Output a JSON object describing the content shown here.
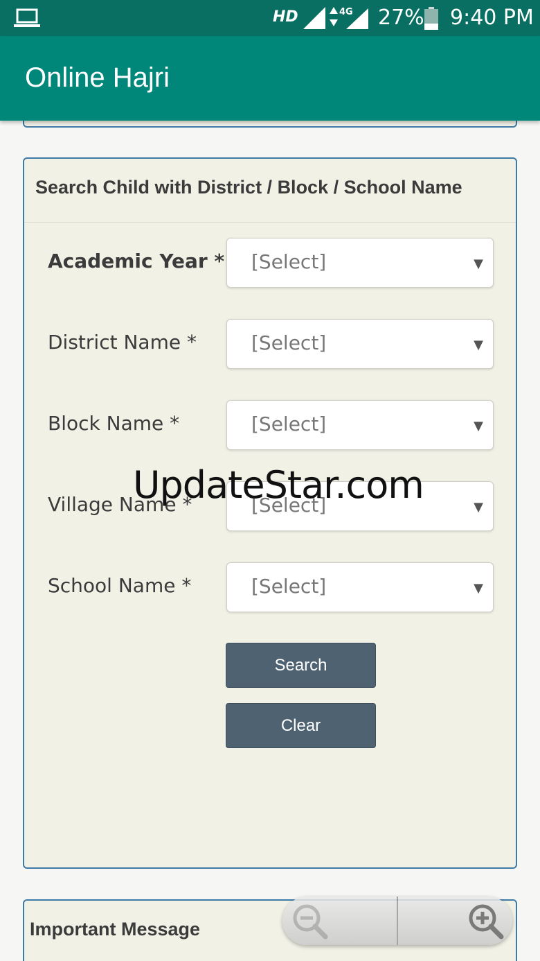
{
  "status_bar": {
    "hd": "HD",
    "network": "4G",
    "battery": "27%",
    "time": "9:40 PM"
  },
  "app_bar": {
    "title": "Online Hajri"
  },
  "search_panel": {
    "header": "Search Child with District / Block / School Name",
    "fields": [
      {
        "label": "Academic Year *",
        "value": "[Select]"
      },
      {
        "label": "District Name *",
        "value": "[Select]"
      },
      {
        "label": "Block Name *",
        "value": "[Select]"
      },
      {
        "label": "Village Name *",
        "value": "[Select]"
      },
      {
        "label": "School Name *",
        "value": "[Select]"
      }
    ],
    "search_label": "Search",
    "clear_label": "Clear"
  },
  "watermark": "UpdateStar.com",
  "message_panel": {
    "header": "Important Message"
  },
  "colors": {
    "status_bar": "#0a6f63",
    "app_bar": "#00877a",
    "panel_border": "#3e7aa5",
    "button": "#4e6272"
  },
  "icons": [
    "laptop-icon",
    "signal-icon",
    "network-4g-icon",
    "battery-icon",
    "caret-down-icon",
    "zoom-out-icon",
    "zoom-in-icon"
  ]
}
